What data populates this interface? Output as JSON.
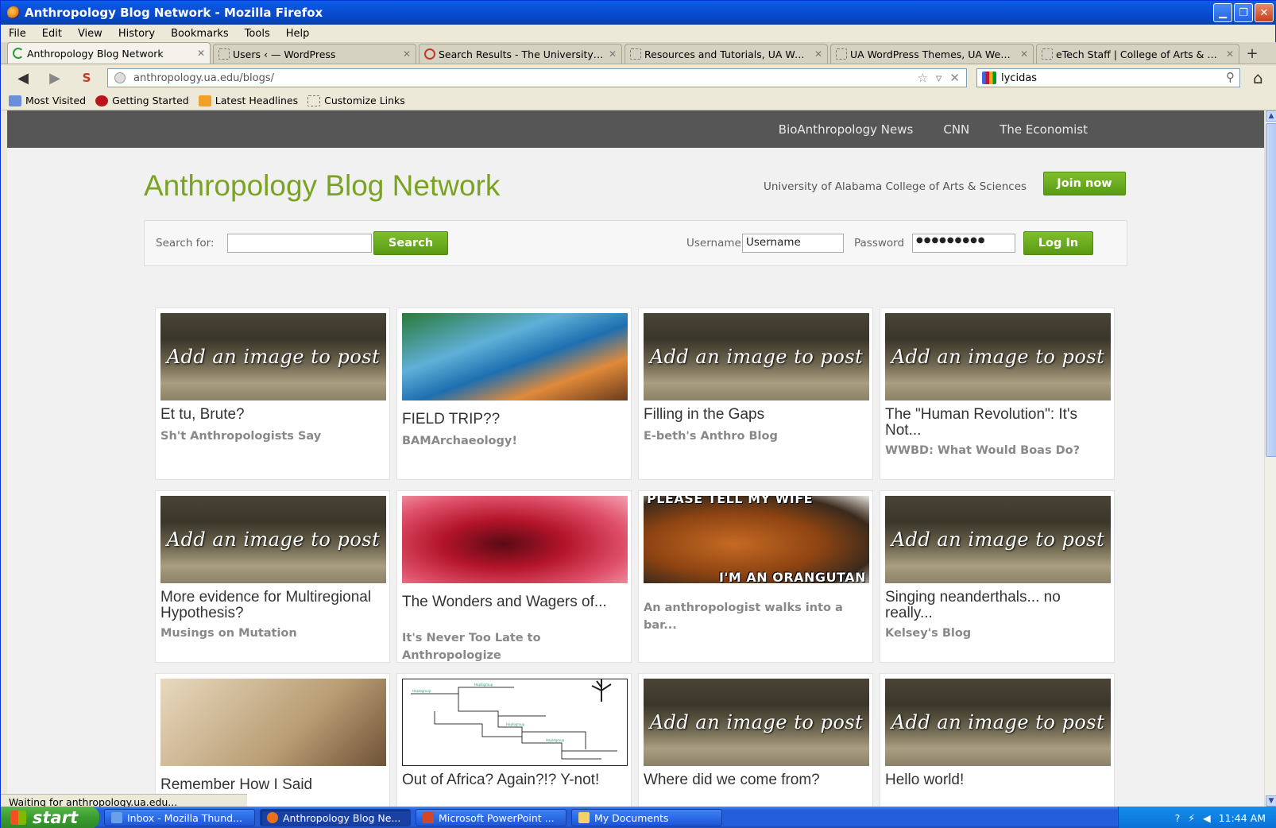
{
  "window": {
    "title": "Anthropology Blog Network - Mozilla Firefox"
  },
  "menu": [
    "File",
    "Edit",
    "View",
    "History",
    "Bookmarks",
    "Tools",
    "Help"
  ],
  "tabs": [
    {
      "label": "Anthropology Blog Network",
      "active": true
    },
    {
      "label": "Users ‹ — WordPress"
    },
    {
      "label": "Search Results - The University ..."
    },
    {
      "label": "Resources and Tutorials, UA We..."
    },
    {
      "label": "UA WordPress Themes, UA Web..."
    },
    {
      "label": "eTech Staff | College of Arts & S..."
    }
  ],
  "address": {
    "url": "anthropology.ua.edu/blogs/"
  },
  "search_engine_box": {
    "value": "lycidas"
  },
  "bookmarks": [
    "Most Visited",
    "Getting Started",
    "Latest Headlines",
    "Customize Links"
  ],
  "site": {
    "topnav": [
      "BioAnthropology News",
      "CNN",
      "The Economist"
    ],
    "title": "Anthropology Blog Network",
    "tagline": "University of Alabama College of Arts & Sciences",
    "join_label": "Join now",
    "search_label": "Search for:",
    "search_button": "Search",
    "username_label": "Username",
    "username_value": "Username",
    "password_label": "Password",
    "password_value": "●●●●●●●●●",
    "login_button": "Log In"
  },
  "placeholder_image_text": "Add an image to post",
  "posts": [
    {
      "title": "Et tu, Brute?",
      "blog": "Sh't Anthropologists Say",
      "image": "placeholder"
    },
    {
      "title": "FIELD TRIP??",
      "blog": "BAMArchaeology!",
      "image": "croods"
    },
    {
      "title": "Filling in the Gaps",
      "blog": "E-beth's Anthro Blog",
      "image": "placeholder"
    },
    {
      "title": "The \"Human Revolution\": It's Not...",
      "blog": "WWBD: What Would Boas Do?",
      "image": "placeholder"
    },
    {
      "title": "More evidence for Multiregional Hypothesis?",
      "blog": "Musings on Mutation",
      "image": "placeholder"
    },
    {
      "title": "The Wonders and Wagers of...",
      "blog": "It's Never Too Late to Anthropologize",
      "image": "womb"
    },
    {
      "title": "",
      "blog": "An anthropologist walks into a bar...",
      "image": "orangutan",
      "meme_top": "PLEASE TELL MY WIFE",
      "meme_bottom": "I'M AN ORANGUTAN"
    },
    {
      "title": "Singing neanderthals... no really...",
      "blog": "Kelsey's Blog",
      "image": "placeholder"
    },
    {
      "title": "Remember How I Said",
      "blog": "",
      "image": "sketch"
    },
    {
      "title": "Out of Africa? Again?!? Y-not!",
      "blog": "",
      "image": "tree"
    },
    {
      "title": "Where did we come from?",
      "blog": "",
      "image": "placeholder"
    },
    {
      "title": "Hello world!",
      "blog": "",
      "image": "placeholder"
    }
  ],
  "status": {
    "text": "Waiting for anthropology.ua.edu..."
  },
  "taskbar": {
    "start": "start",
    "items": [
      "Inbox - Mozilla Thund...",
      "Anthropology Blog Ne...",
      "Microsoft PowerPoint ...",
      "My Documents"
    ],
    "clock": "11:44 AM"
  },
  "colors": {
    "accent_green": "#7aa324",
    "topnav_bg": "#565656",
    "titlebar_blue": "#0a4fd6"
  }
}
